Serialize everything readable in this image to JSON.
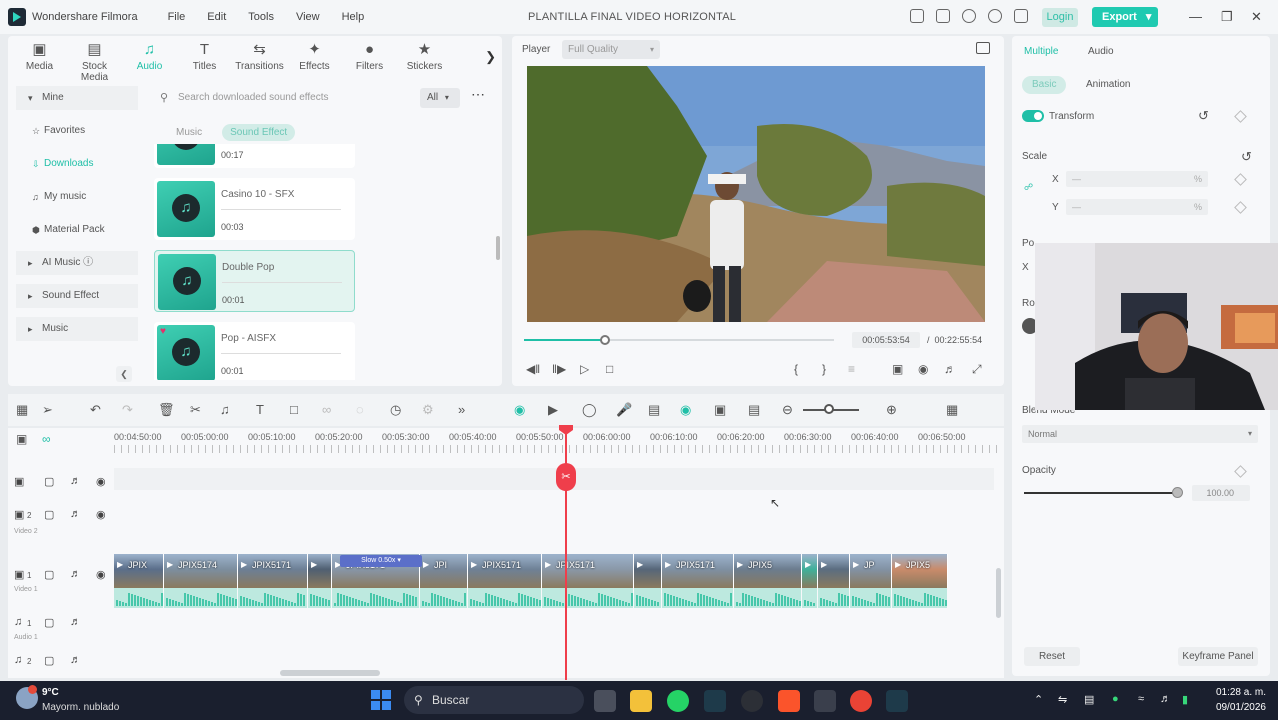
{
  "app": {
    "name": "Wondershare Filmora",
    "project_title": "PLANTILLA FINAL VIDEO HORIZONTAL",
    "menu": [
      "File",
      "Edit",
      "Tools",
      "View",
      "Help"
    ],
    "login_label": "Login",
    "export_label": "Export"
  },
  "media_panel": {
    "tabs": [
      {
        "label": "Media",
        "icon": "media-icon"
      },
      {
        "label": "Stock Media",
        "icon": "stock-media-icon"
      },
      {
        "label": "Audio",
        "icon": "music-note-icon",
        "active": true
      },
      {
        "label": "Titles",
        "icon": "titles-icon"
      },
      {
        "label": "Transitions",
        "icon": "transitions-icon"
      },
      {
        "label": "Effects",
        "icon": "effects-icon"
      },
      {
        "label": "Filters",
        "icon": "filters-icon"
      },
      {
        "label": "Stickers",
        "icon": "stickers-icon"
      }
    ],
    "sidebar": {
      "mine": "Mine",
      "favorites": "Favorites",
      "downloads": "Downloads",
      "my_music": "My music",
      "material_pack": "Material Pack",
      "ai_music": "AI Music",
      "sound_effect": "Sound Effect",
      "music": "Music"
    },
    "search_placeholder": "Search downloaded sound effects",
    "filter_value": "All",
    "subtabs": [
      "Music",
      "Sound Effect"
    ],
    "items": [
      {
        "name": "",
        "duration": "00:17"
      },
      {
        "name": "Casino 10 - SFX",
        "duration": "00:03"
      },
      {
        "name": "Double Pop",
        "duration": "00:01"
      },
      {
        "name": "Pop - AISFX",
        "duration": "00:01"
      }
    ]
  },
  "player": {
    "label": "Player",
    "quality": "Full Quality",
    "current_time": "00:05:53:54",
    "separator": "/",
    "total_time": "00:22:55:54",
    "progress": 0.26
  },
  "properties": {
    "tabs": [
      "Multiple",
      "Audio"
    ],
    "subtabs": [
      "Basic",
      "Animation"
    ],
    "transform_label": "Transform",
    "scale_label": "Scale",
    "x_label": "X",
    "y_label": "Y",
    "x_value": "—",
    "y_value": "—",
    "unit": "%",
    "position_label": "Po",
    "position_x": "X",
    "rotate_label": "Ro",
    "blend_label": "Blend Mode",
    "blend_value": "Normal",
    "opacity_label": "Opacity",
    "opacity_value": "100.00",
    "reset_label": "Reset",
    "keyframe_label": "Keyframe Panel"
  },
  "timeline": {
    "ruler": [
      "00:04:50:00",
      "00:05:00:00",
      "00:05:10:00",
      "00:05:20:00",
      "00:05:30:00",
      "00:05:40:00",
      "00:05:50:00",
      "00:06:00:00",
      "00:06:10:00",
      "00:06:20:00",
      "00:06:30:00",
      "00:06:40:00",
      "00:06:50:00"
    ],
    "tracks": [
      {
        "num": "2",
        "name": "Video 2"
      },
      {
        "num": "1",
        "name": "Video 1"
      },
      {
        "num": "1",
        "name": "Audio 1"
      },
      {
        "num": "2",
        "name": ""
      }
    ],
    "clips": [
      {
        "label": "JPIX"
      },
      {
        "label": "JPIX5174"
      },
      {
        "label": "JPIX5171"
      },
      {
        "label": ""
      },
      {
        "label": "JPIX5171"
      },
      {
        "label": "JPI"
      },
      {
        "label": "JPIX5171"
      },
      {
        "label": "JPIX5171"
      },
      {
        "label": ""
      },
      {
        "label": "JPIX5171"
      },
      {
        "label": "JPIX5"
      },
      {
        "label": ""
      },
      {
        "label": ""
      },
      {
        "label": "JP"
      },
      {
        "label": "JPIX5"
      }
    ],
    "speed_badge": "Slow 0.50x"
  },
  "taskbar": {
    "temperature": "9°C",
    "weather": "Mayorm. nublado",
    "search": "Buscar",
    "time": "01:28 a. m.",
    "date": "09/01/2026"
  }
}
